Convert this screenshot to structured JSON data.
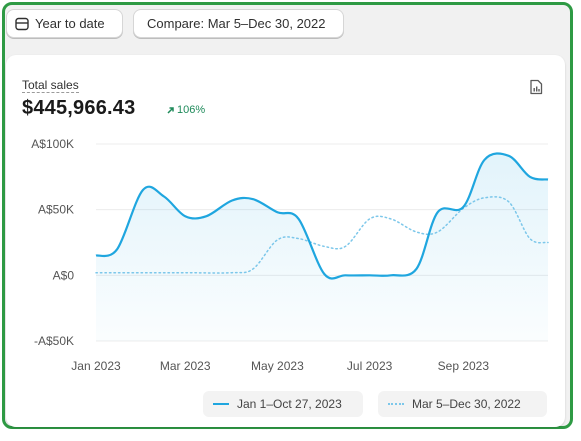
{
  "toolbar": {
    "date_range_label": "Year to date",
    "compare_label": "Compare: Mar 5–Dec 30, 2022"
  },
  "metric": {
    "label": "Total sales",
    "value": "$445,966.43",
    "change": "106%"
  },
  "icons": {
    "date": "calendar-icon",
    "export": "export-report-icon",
    "change": "arrow-up-right-icon"
  },
  "colors": {
    "accent": "#1fa6df",
    "comparison": "#7cc7ea",
    "positive": "#1e8a5a",
    "frame": "#2e9a44"
  },
  "chart_data": {
    "type": "area",
    "x_ticks": [
      "Jan 2023",
      "Mar 2023",
      "May 2023",
      "Jul 2023",
      "Sep 2023"
    ],
    "y_ticks": [
      "A$100K",
      "A$50K",
      "A$0",
      "-A$50K"
    ],
    "ylim": [
      -50000,
      100000
    ],
    "grid": true,
    "legend_position": "bottom-right",
    "series": [
      {
        "name": "Jan 1–Oct 27, 2023",
        "style": "solid",
        "x": [
          "2023-01-01",
          "2023-01-15",
          "2023-02-01",
          "2023-02-15",
          "2023-03-01",
          "2023-03-15",
          "2023-04-01",
          "2023-04-15",
          "2023-05-01",
          "2023-05-15",
          "2023-06-01",
          "2023-06-15",
          "2023-07-01",
          "2023-07-15",
          "2023-08-01",
          "2023-08-15",
          "2023-09-01",
          "2023-09-15",
          "2023-10-01",
          "2023-10-15",
          "2023-10-27"
        ],
        "values": [
          15000,
          20000,
          65000,
          60000,
          45000,
          45000,
          57000,
          58000,
          48000,
          43000,
          1000,
          0,
          0,
          0,
          5000,
          48000,
          52000,
          88000,
          91000,
          75000,
          73000
        ]
      },
      {
        "name": "Mar 5–Dec 30, 2022",
        "style": "dotted",
        "x": [
          "2023-01-01",
          "2023-02-01",
          "2023-03-01",
          "2023-04-01",
          "2023-04-15",
          "2023-05-01",
          "2023-05-15",
          "2023-06-01",
          "2023-06-15",
          "2023-07-01",
          "2023-07-15",
          "2023-08-01",
          "2023-08-15",
          "2023-09-01",
          "2023-09-15",
          "2023-10-01",
          "2023-10-15",
          "2023-10-27"
        ],
        "values": [
          2000,
          2000,
          2000,
          2000,
          5000,
          27000,
          28000,
          22000,
          22000,
          43000,
          43000,
          33000,
          33000,
          51000,
          59000,
          56000,
          28000,
          25000
        ]
      }
    ]
  }
}
